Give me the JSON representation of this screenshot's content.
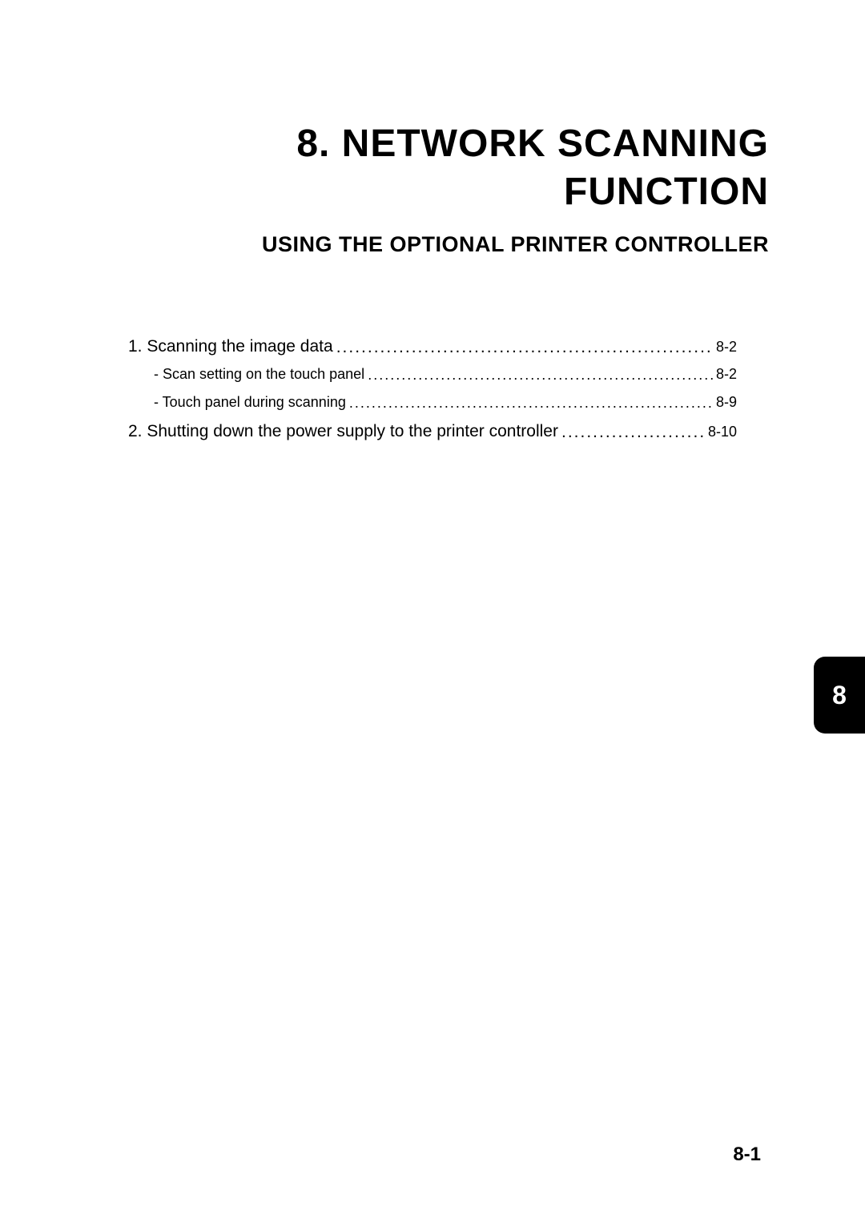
{
  "chapter": {
    "title_line1": "8. NETWORK SCANNING",
    "title_line2": "FUNCTION",
    "subtitle": "USING THE OPTIONAL PRINTER CONTROLLER"
  },
  "toc": [
    {
      "level": 1,
      "label": "1. Scanning the image data",
      "page": "8-2"
    },
    {
      "level": 2,
      "label": "- Scan setting on the touch panel",
      "page": "8-2"
    },
    {
      "level": 2,
      "label": "- Touch panel during scanning",
      "page": "8-9"
    },
    {
      "level": 1,
      "label": "2. Shutting down the power supply to the printer controller",
      "page": "8-10"
    }
  ],
  "tab": "8",
  "page_number": "8-1"
}
